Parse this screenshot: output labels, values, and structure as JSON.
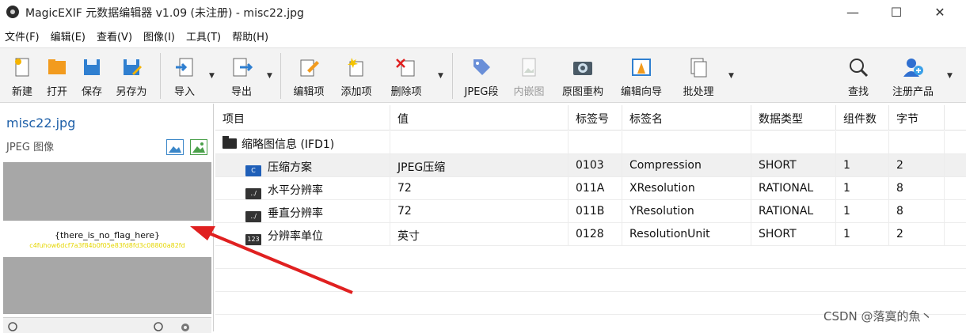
{
  "window": {
    "title": "MagicEXIF 元数据编辑器 v1.09 (未注册) - misc22.jpg",
    "minimize": "—",
    "maximize": "☐",
    "close": "✕"
  },
  "menu": [
    "文件(F)",
    "编辑(E)",
    "查看(V)",
    "图像(I)",
    "工具(T)",
    "帮助(H)"
  ],
  "toolbar": {
    "new": "新建",
    "open": "打开",
    "save": "保存",
    "save_as": "另存为",
    "import": "导入",
    "export": "导出",
    "edit_item": "编辑项",
    "add_item": "添加项",
    "delete_item": "删除项",
    "jpeg_seg": "JPEG段",
    "embedded": "内嵌图",
    "restore": "原图重构",
    "wizard": "编辑向导",
    "batch": "批处理",
    "find": "查找",
    "register": "注册产品"
  },
  "left": {
    "file_name": "misc22.jpg",
    "file_type": "JPEG 图像",
    "flag_text": "{there_is_no_flag_here}",
    "flag_hash": "c4fuhow6dcf7a3f84b0f05e83fd8fd3c08800a82fd"
  },
  "grid": {
    "headers": [
      "项目",
      "值",
      "标签号",
      "标签名",
      "数据类型",
      "组件数",
      "字节"
    ],
    "group": "缩略图信息 (IFD1)",
    "rows": [
      {
        "icon": "C",
        "name": "压缩方案",
        "value": "JPEG压缩",
        "tag": "0103",
        "tagname": "Compression",
        "type": "SHORT",
        "count": "1",
        "bytes": "2"
      },
      {
        "icon": "../",
        "name": "水平分辨率",
        "value": "72",
        "tag": "011A",
        "tagname": "XResolution",
        "type": "RATIONAL",
        "count": "1",
        "bytes": "8"
      },
      {
        "icon": "../",
        "name": "垂直分辨率",
        "value": "72",
        "tag": "011B",
        "tagname": "YResolution",
        "type": "RATIONAL",
        "count": "1",
        "bytes": "8"
      },
      {
        "icon": "123",
        "name": "分辨率单位",
        "value": "英寸",
        "tag": "0128",
        "tagname": "ResolutionUnit",
        "type": "SHORT",
        "count": "1",
        "bytes": "2"
      }
    ]
  },
  "watermark": "CSDN @落寞的魚丶",
  "colors": {
    "accent": "#1d5fa8",
    "arrow": "#e02020",
    "hash": "#e5d600"
  }
}
